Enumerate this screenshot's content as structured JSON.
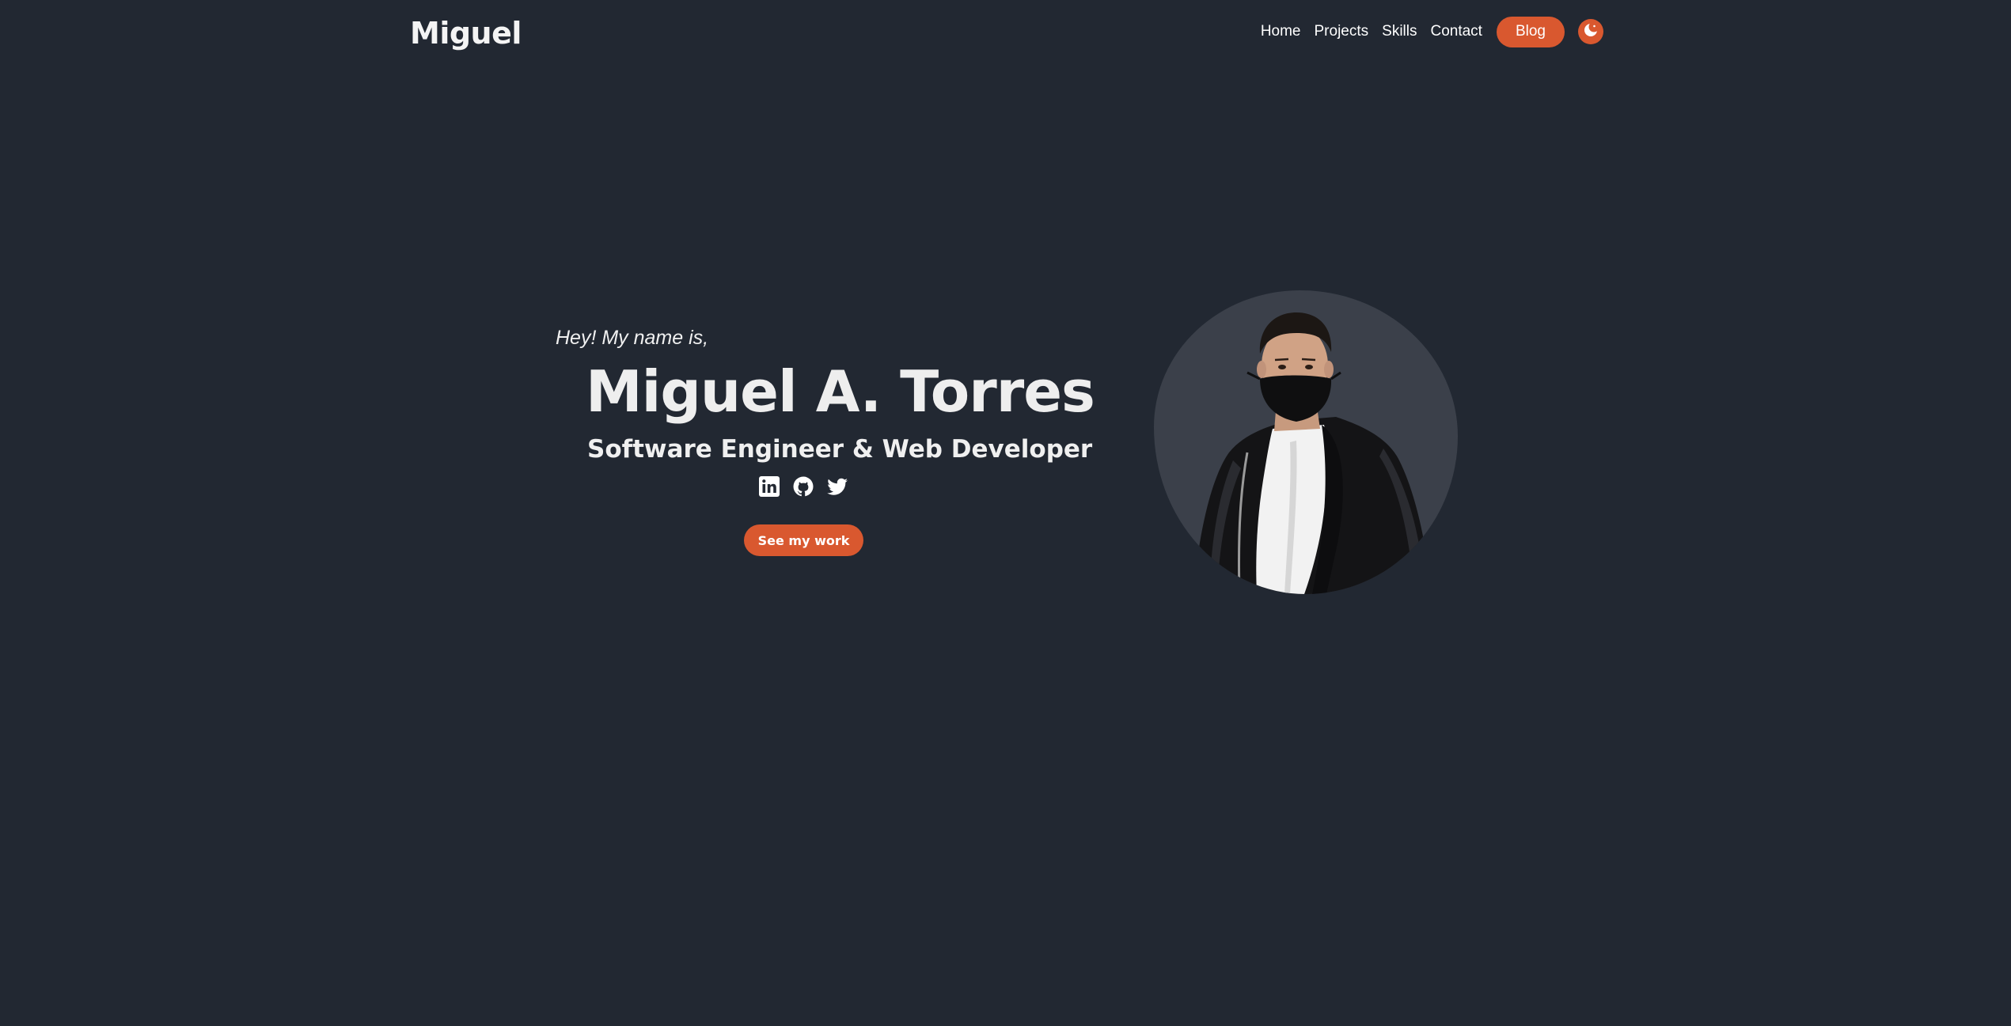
{
  "header": {
    "brand": "Miguel",
    "nav": [
      {
        "label": "Home"
      },
      {
        "label": "Projects"
      },
      {
        "label": "Skills"
      },
      {
        "label": "Contact"
      }
    ],
    "blog_label": "Blog",
    "theme_toggle_icon": "moon-icon"
  },
  "hero": {
    "greeting": "Hey! My name is,",
    "name": "Miguel A. Torres",
    "role": "Software Engineer & Web Developer",
    "socials": [
      {
        "icon": "linkedin-icon"
      },
      {
        "icon": "github-icon"
      },
      {
        "icon": "twitter-icon"
      }
    ],
    "cta_label": "See my work",
    "portrait_icon": "profile-photo"
  },
  "colors": {
    "background": "#222832",
    "accent": "#d9582f",
    "portrait_bg": "#3b404a",
    "text": "#f2f2f2"
  }
}
